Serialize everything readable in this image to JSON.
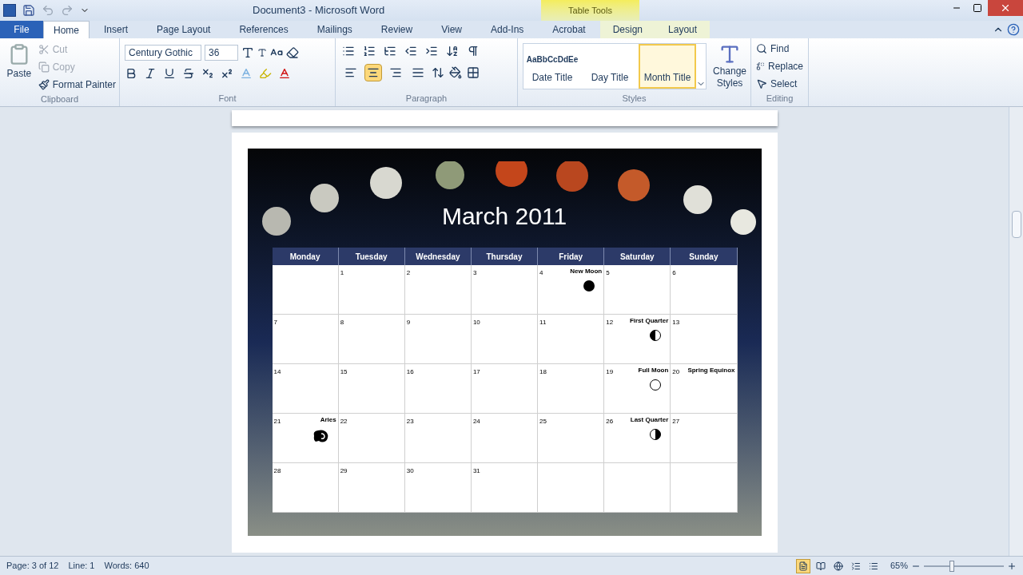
{
  "window": {
    "title": "Document3 - Microsoft Word"
  },
  "context_tab_group": {
    "label": "Table Tools"
  },
  "tabs": [
    {
      "label": "File",
      "kind": "file",
      "selected": false
    },
    {
      "label": "Home",
      "kind": "normal",
      "selected": true
    },
    {
      "label": "Insert",
      "kind": "normal",
      "selected": false
    },
    {
      "label": "Page Layout",
      "kind": "normal",
      "selected": false
    },
    {
      "label": "References",
      "kind": "normal",
      "selected": false
    },
    {
      "label": "Mailings",
      "kind": "normal",
      "selected": false
    },
    {
      "label": "Review",
      "kind": "normal",
      "selected": false
    },
    {
      "label": "View",
      "kind": "normal",
      "selected": false
    },
    {
      "label": "Add-Ins",
      "kind": "normal",
      "selected": false
    },
    {
      "label": "Acrobat",
      "kind": "normal",
      "selected": false
    },
    {
      "label": "Design",
      "kind": "contextual",
      "selected": false
    },
    {
      "label": "Layout",
      "kind": "contextual",
      "selected": false
    }
  ],
  "clipboard": {
    "label": "Clipboard",
    "paste": "Paste",
    "items": [
      {
        "label": "Cut",
        "kind": "cut",
        "disabled": true
      },
      {
        "label": "Copy",
        "kind": "copy",
        "disabled": true
      },
      {
        "label": "Format Painter",
        "kind": "painter",
        "disabled": false
      }
    ]
  },
  "font": {
    "label": "Font",
    "font_name": "Century Gothic",
    "font_size": "36"
  },
  "paragraph": {
    "label": "Paragraph",
    "alignments": [
      {
        "kind": "left",
        "selected": false
      },
      {
        "kind": "center",
        "selected": true
      },
      {
        "kind": "right",
        "selected": false
      },
      {
        "kind": "justify",
        "selected": false
      }
    ]
  },
  "styles": {
    "label": "Styles",
    "change_styles": "Change Styles",
    "items": [
      {
        "sample": "AaBbCcDdEe",
        "label": "Date Title",
        "selected": false
      },
      {
        "label": "Day Title",
        "selected": false
      },
      {
        "label": "Month Title",
        "selected": true
      }
    ]
  },
  "editing": {
    "label": "Editing",
    "items": [
      {
        "label": "Find",
        "kind": "find"
      },
      {
        "label": "Replace",
        "kind": "replace"
      },
      {
        "label": "Select",
        "kind": "select"
      }
    ]
  },
  "calendar": {
    "title": "March 2011",
    "days": [
      "Monday",
      "Tuesday",
      "Wednesday",
      "Thursday",
      "Friday",
      "Saturday",
      "Sunday"
    ],
    "weeks": [
      [
        {
          "kind": "blank"
        },
        {
          "day": "1",
          "kind": "plain"
        },
        {
          "day": "2",
          "kind": "plain"
        },
        {
          "day": "3",
          "kind": "plain"
        },
        {
          "day": "4",
          "event": "New Moon",
          "kind": "new_moon"
        },
        {
          "day": "5",
          "kind": "plain"
        },
        {
          "day": "6",
          "kind": "plain"
        }
      ],
      [
        {
          "day": "7",
          "kind": "plain"
        },
        {
          "day": "8",
          "kind": "plain"
        },
        {
          "day": "9",
          "kind": "plain"
        },
        {
          "day": "10",
          "kind": "plain"
        },
        {
          "day": "11",
          "kind": "plain"
        },
        {
          "day": "12",
          "event": "First Quarter",
          "kind": "first_quarter"
        },
        {
          "day": "13",
          "kind": "plain"
        }
      ],
      [
        {
          "day": "14",
          "kind": "plain"
        },
        {
          "day": "15",
          "kind": "plain"
        },
        {
          "day": "16",
          "kind": "plain"
        },
        {
          "day": "17",
          "kind": "plain"
        },
        {
          "day": "18",
          "kind": "plain"
        },
        {
          "day": "19",
          "event": "Full Moon",
          "kind": "full_moon"
        },
        {
          "day": "20",
          "event": "Spring Equinox",
          "kind": "plain"
        }
      ],
      [
        {
          "day": "21",
          "event": "Aries",
          "kind": "zodiac"
        },
        {
          "day": "22",
          "kind": "plain"
        },
        {
          "day": "23",
          "kind": "plain"
        },
        {
          "day": "24",
          "kind": "plain"
        },
        {
          "day": "25",
          "kind": "plain"
        },
        {
          "day": "26",
          "event": "Last Quarter",
          "kind": "last_quarter"
        },
        {
          "day": "27",
          "kind": "plain"
        }
      ],
      [
        {
          "day": "28",
          "kind": "plain"
        },
        {
          "day": "29",
          "kind": "plain"
        },
        {
          "day": "30",
          "kind": "plain"
        },
        {
          "day": "31",
          "kind": "plain"
        },
        {
          "kind": "blank"
        },
        {
          "kind": "blank"
        },
        {
          "kind": "blank"
        }
      ]
    ]
  },
  "status_bar": {
    "page": "Page: 3 of 12",
    "line": "Line: 1",
    "words": "Words: 640",
    "views": [
      {
        "kind": "print",
        "selected": true
      },
      {
        "kind": "reading",
        "selected": false
      },
      {
        "kind": "web",
        "selected": false
      },
      {
        "kind": "outline",
        "selected": false
      },
      {
        "kind": "draft",
        "selected": false
      }
    ],
    "zoom": "65%",
    "zoom_level": {
      "level": 0.35
    }
  }
}
